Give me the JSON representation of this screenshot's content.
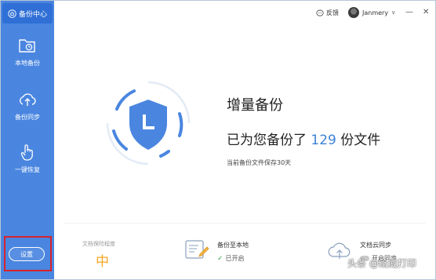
{
  "brand": {
    "label": "备份中心",
    "icon": "home-icon"
  },
  "sidebar": {
    "items": [
      {
        "label": "本地备份",
        "icon": "folder-clock-icon"
      },
      {
        "label": "备份同步",
        "icon": "cloud-upload-icon"
      },
      {
        "label": "一键恢复",
        "icon": "hand-pointer-icon"
      }
    ],
    "settings_label": "设置"
  },
  "topbar": {
    "feedback_label": "反馈",
    "username": "Janmery",
    "minimize": "—",
    "close": "✕"
  },
  "hero": {
    "title": "增量备份",
    "line_prefix": "已为您备份了 ",
    "count": "129",
    "line_suffix": " 份文件",
    "note": "当前备份文件保存30天",
    "icon": "shield-clock-icon"
  },
  "bottom": {
    "risk_label": "文档保险程度",
    "risk_value": "中",
    "local": {
      "title": "备份至本地",
      "status": "已开启",
      "icon": "document-edit-icon"
    },
    "cloud": {
      "title": "文档云同步",
      "status": "开启同步",
      "icon": "cloud-upload-icon"
    }
  },
  "watermark": "头条 @绘威打印",
  "colors": {
    "sidebar": "#4a86e0",
    "accent": "#3b82d4",
    "risk": "#f5a623",
    "highlight_border": "#d9222a"
  }
}
